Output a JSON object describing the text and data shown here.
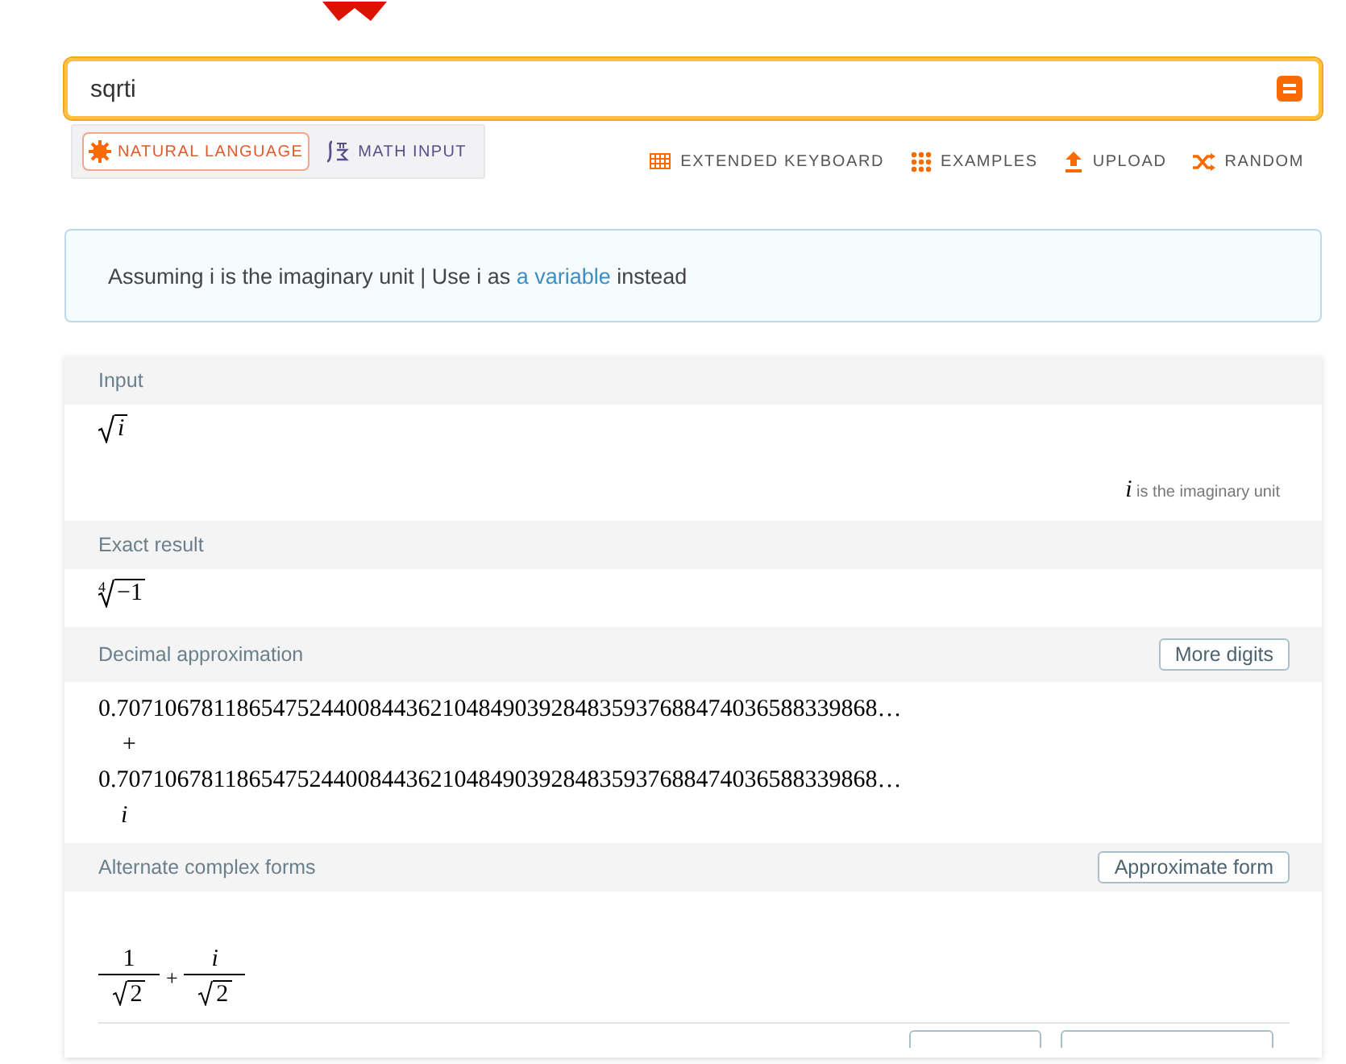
{
  "search": {
    "value": "sqrti"
  },
  "modes": [
    {
      "label": "NATURAL LANGUAGE",
      "kind": "natural",
      "selected": true
    },
    {
      "label": "MATH INPUT",
      "kind": "math",
      "selected": false
    }
  ],
  "tools": [
    {
      "label": "EXTENDED KEYBOARD",
      "kind": "keyboard"
    },
    {
      "label": "EXAMPLES",
      "kind": "examples"
    },
    {
      "label": "UPLOAD",
      "kind": "upload"
    },
    {
      "label": "RANDOM",
      "kind": "random"
    }
  ],
  "assumption": {
    "text": "Assuming i is the imaginary unit | Use i as",
    "link": "a variable",
    "after": "instead"
  },
  "pods": [
    {
      "title": "Input",
      "kind": "radical",
      "radicand": "i",
      "italic": true,
      "note_symbol": "i",
      "note": "is the imaginary unit"
    },
    {
      "title": "Exact result",
      "kind": "radical",
      "index": "4",
      "radicand": "−1"
    },
    {
      "title": "Decimal approximation",
      "kind": "lines",
      "button": "More digits",
      "lines": [
        "0.707106781186547524400844362104849039284835937688474036588339868…",
        "+",
        "0.707106781186547524400844362104849039284835937688474036588339868…",
        "i"
      ]
    },
    {
      "title": "Alternate complex forms",
      "kind": "fractions",
      "button": "Approximate form",
      "terms": [
        {
          "num": "1",
          "den": "2",
          "italic": false
        },
        {
          "op": "+"
        },
        {
          "num": "i",
          "den": "2",
          "italic": true
        }
      ]
    }
  ]
}
